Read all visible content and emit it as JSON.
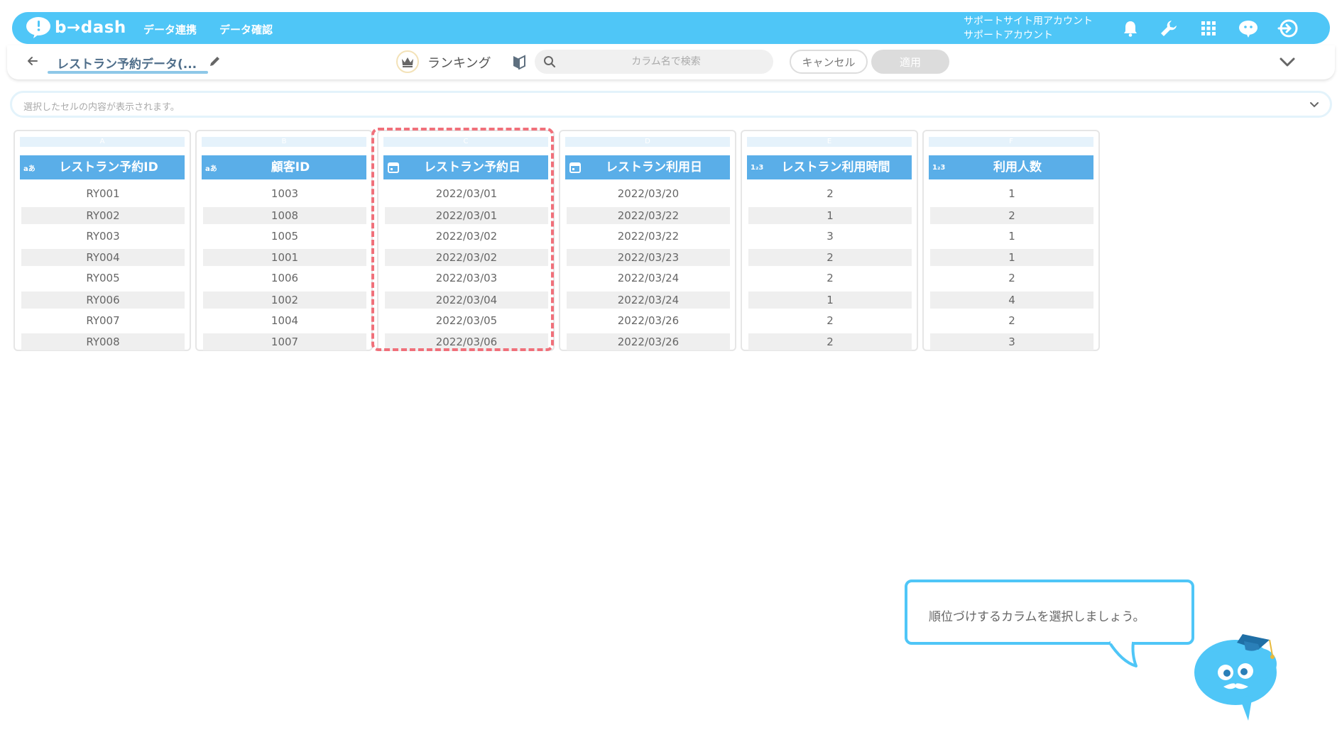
{
  "header": {
    "brand": "b→dash",
    "nav": [
      {
        "label": "データ連携"
      },
      {
        "label": "データ確認"
      }
    ],
    "account_line1": "サポートサイト用アカウント",
    "account_line2": "サポートアカウント",
    "icons": [
      "bell-icon",
      "wrench-icon",
      "apps-grid-icon",
      "support-chat-icon",
      "logout-icon"
    ],
    "accent_color": "#4fc6f7"
  },
  "toolbar": {
    "dataset_name": "レストラン予約データ(...",
    "tool_title": "ランキング",
    "search_placeholder": "カラム名で検索",
    "cancel_label": "キャンセル",
    "apply_label": "適用"
  },
  "cell_bar": {
    "placeholder": "選択したセルの内容が表示されます。"
  },
  "columns": [
    {
      "letter": "A",
      "type_label": "aあ",
      "type": "text",
      "name": "レストラン予約ID",
      "values": [
        "RY001",
        "RY002",
        "RY003",
        "RY004",
        "RY005",
        "RY006",
        "RY007",
        "RY008"
      ]
    },
    {
      "letter": "B",
      "type_label": "aあ",
      "type": "text",
      "name": "顧客ID",
      "values": [
        "1003",
        "1008",
        "1005",
        "1001",
        "1006",
        "1002",
        "1004",
        "1007"
      ]
    },
    {
      "letter": "C",
      "type_label": "",
      "type": "date",
      "name": "レストラン予約日",
      "selected": true,
      "values": [
        "2022/03/01",
        "2022/03/01",
        "2022/03/02",
        "2022/03/02",
        "2022/03/03",
        "2022/03/04",
        "2022/03/05",
        "2022/03/06"
      ]
    },
    {
      "letter": "D",
      "type_label": "",
      "type": "date",
      "name": "レストラン利用日",
      "values": [
        "2022/03/20",
        "2022/03/22",
        "2022/03/22",
        "2022/03/23",
        "2022/03/24",
        "2022/03/24",
        "2022/03/26",
        "2022/03/26"
      ]
    },
    {
      "letter": "E",
      "type_label": "1₂3",
      "type": "number",
      "name": "レストラン利用時間",
      "values": [
        "2",
        "1",
        "3",
        "2",
        "2",
        "1",
        "2",
        "2"
      ]
    },
    {
      "letter": "F",
      "type_label": "1₂3",
      "type": "number",
      "name": "利用人数",
      "values": [
        "1",
        "2",
        "1",
        "1",
        "2",
        "4",
        "2",
        "3"
      ]
    }
  ],
  "assistant": {
    "message": "順位づけするカラムを選択しましょう。"
  }
}
